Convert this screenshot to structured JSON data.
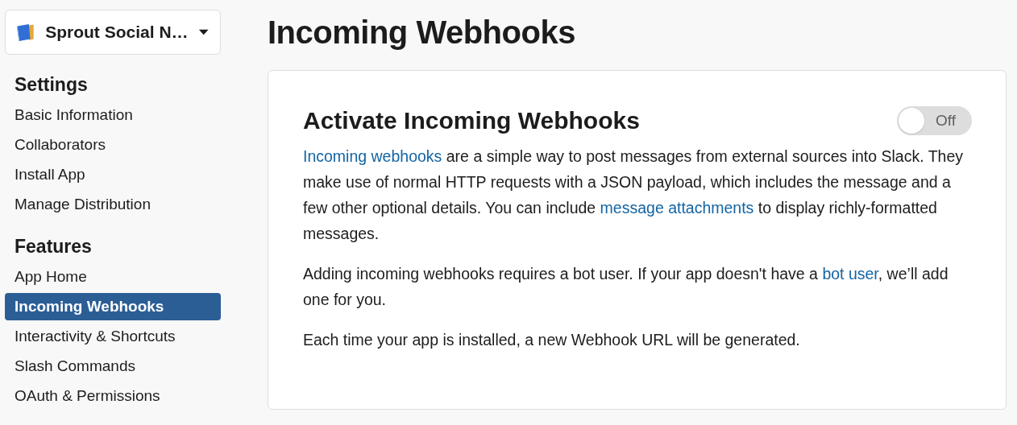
{
  "workspace": {
    "name": "Sprout Social N…"
  },
  "sidebar": {
    "sections": [
      {
        "title": "Settings",
        "items": [
          {
            "label": "Basic Information",
            "selected": false
          },
          {
            "label": "Collaborators",
            "selected": false
          },
          {
            "label": "Install App",
            "selected": false
          },
          {
            "label": "Manage Distribution",
            "selected": false
          }
        ]
      },
      {
        "title": "Features",
        "items": [
          {
            "label": "App Home",
            "selected": false
          },
          {
            "label": "Incoming Webhooks",
            "selected": true
          },
          {
            "label": "Interactivity & Shortcuts",
            "selected": false
          },
          {
            "label": "Slash Commands",
            "selected": false
          },
          {
            "label": "OAuth & Permissions",
            "selected": false
          }
        ]
      }
    ]
  },
  "page": {
    "title": "Incoming Webhooks"
  },
  "card": {
    "title": "Activate Incoming Webhooks",
    "toggle": {
      "on": false,
      "label": "Off"
    },
    "paragraphs": [
      [
        {
          "kind": "link",
          "text": "Incoming webhooks"
        },
        {
          "kind": "text",
          "text": " are a simple way to post messages from external sources into Slack. They make use of normal HTTP requests with a JSON payload, which includes the message and a few other optional details. You can include "
        },
        {
          "kind": "link",
          "text": "message attachments"
        },
        {
          "kind": "text",
          "text": " to display richly-formatted messages."
        }
      ],
      [
        {
          "kind": "text",
          "text": "Adding incoming webhooks requires a bot user. If your app doesn't have a "
        },
        {
          "kind": "link",
          "text": "bot user"
        },
        {
          "kind": "text",
          "text": ", we’ll add one for you."
        }
      ],
      [
        {
          "kind": "text",
          "text": "Each time your app is installed, a new Webhook URL will be generated."
        }
      ]
    ]
  }
}
